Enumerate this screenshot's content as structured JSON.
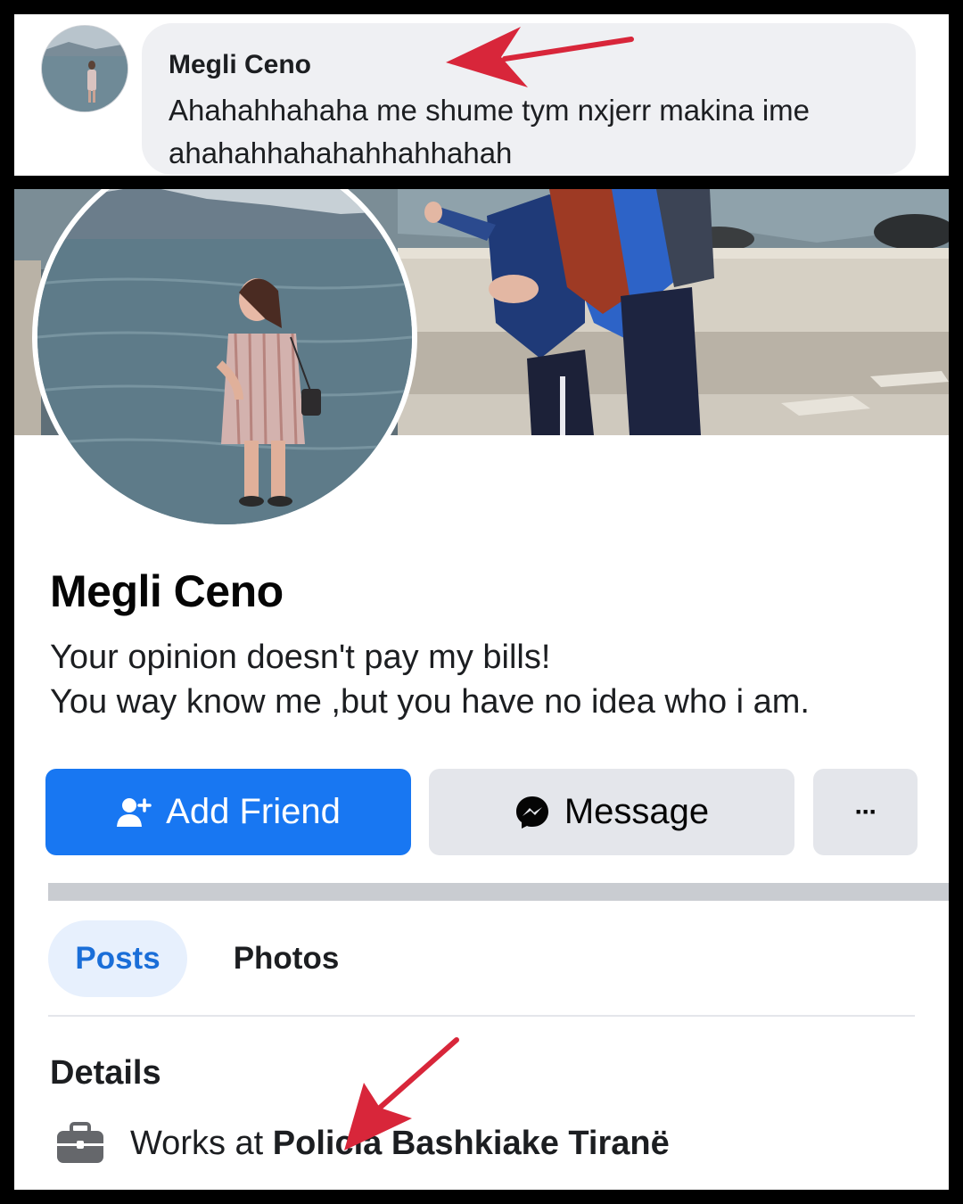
{
  "comment": {
    "author": "Megli Ceno",
    "text": "Ahahahhahaha me shume tym nxjerr makina ime ahahahhahahahhahhahah"
  },
  "profile": {
    "name": "Megli Ceno",
    "bio_line1": "Your opinion doesn't pay my bills!",
    "bio_line2": "You way know me ,but you have no idea who i am."
  },
  "actions": {
    "add_friend": "Add Friend",
    "message": "Message",
    "more": "···"
  },
  "tabs": [
    {
      "label": "Posts",
      "active": true
    },
    {
      "label": "Photos",
      "active": false
    }
  ],
  "details": {
    "heading": "Details",
    "work_prefix": "Works at ",
    "work_place": "Policia Bashkiake Tiranë",
    "icon": "briefcase-icon"
  },
  "colors": {
    "primary": "#1877f2",
    "annotation_arrow": "#d8263a",
    "tab_active_bg": "#e7f0fd"
  }
}
